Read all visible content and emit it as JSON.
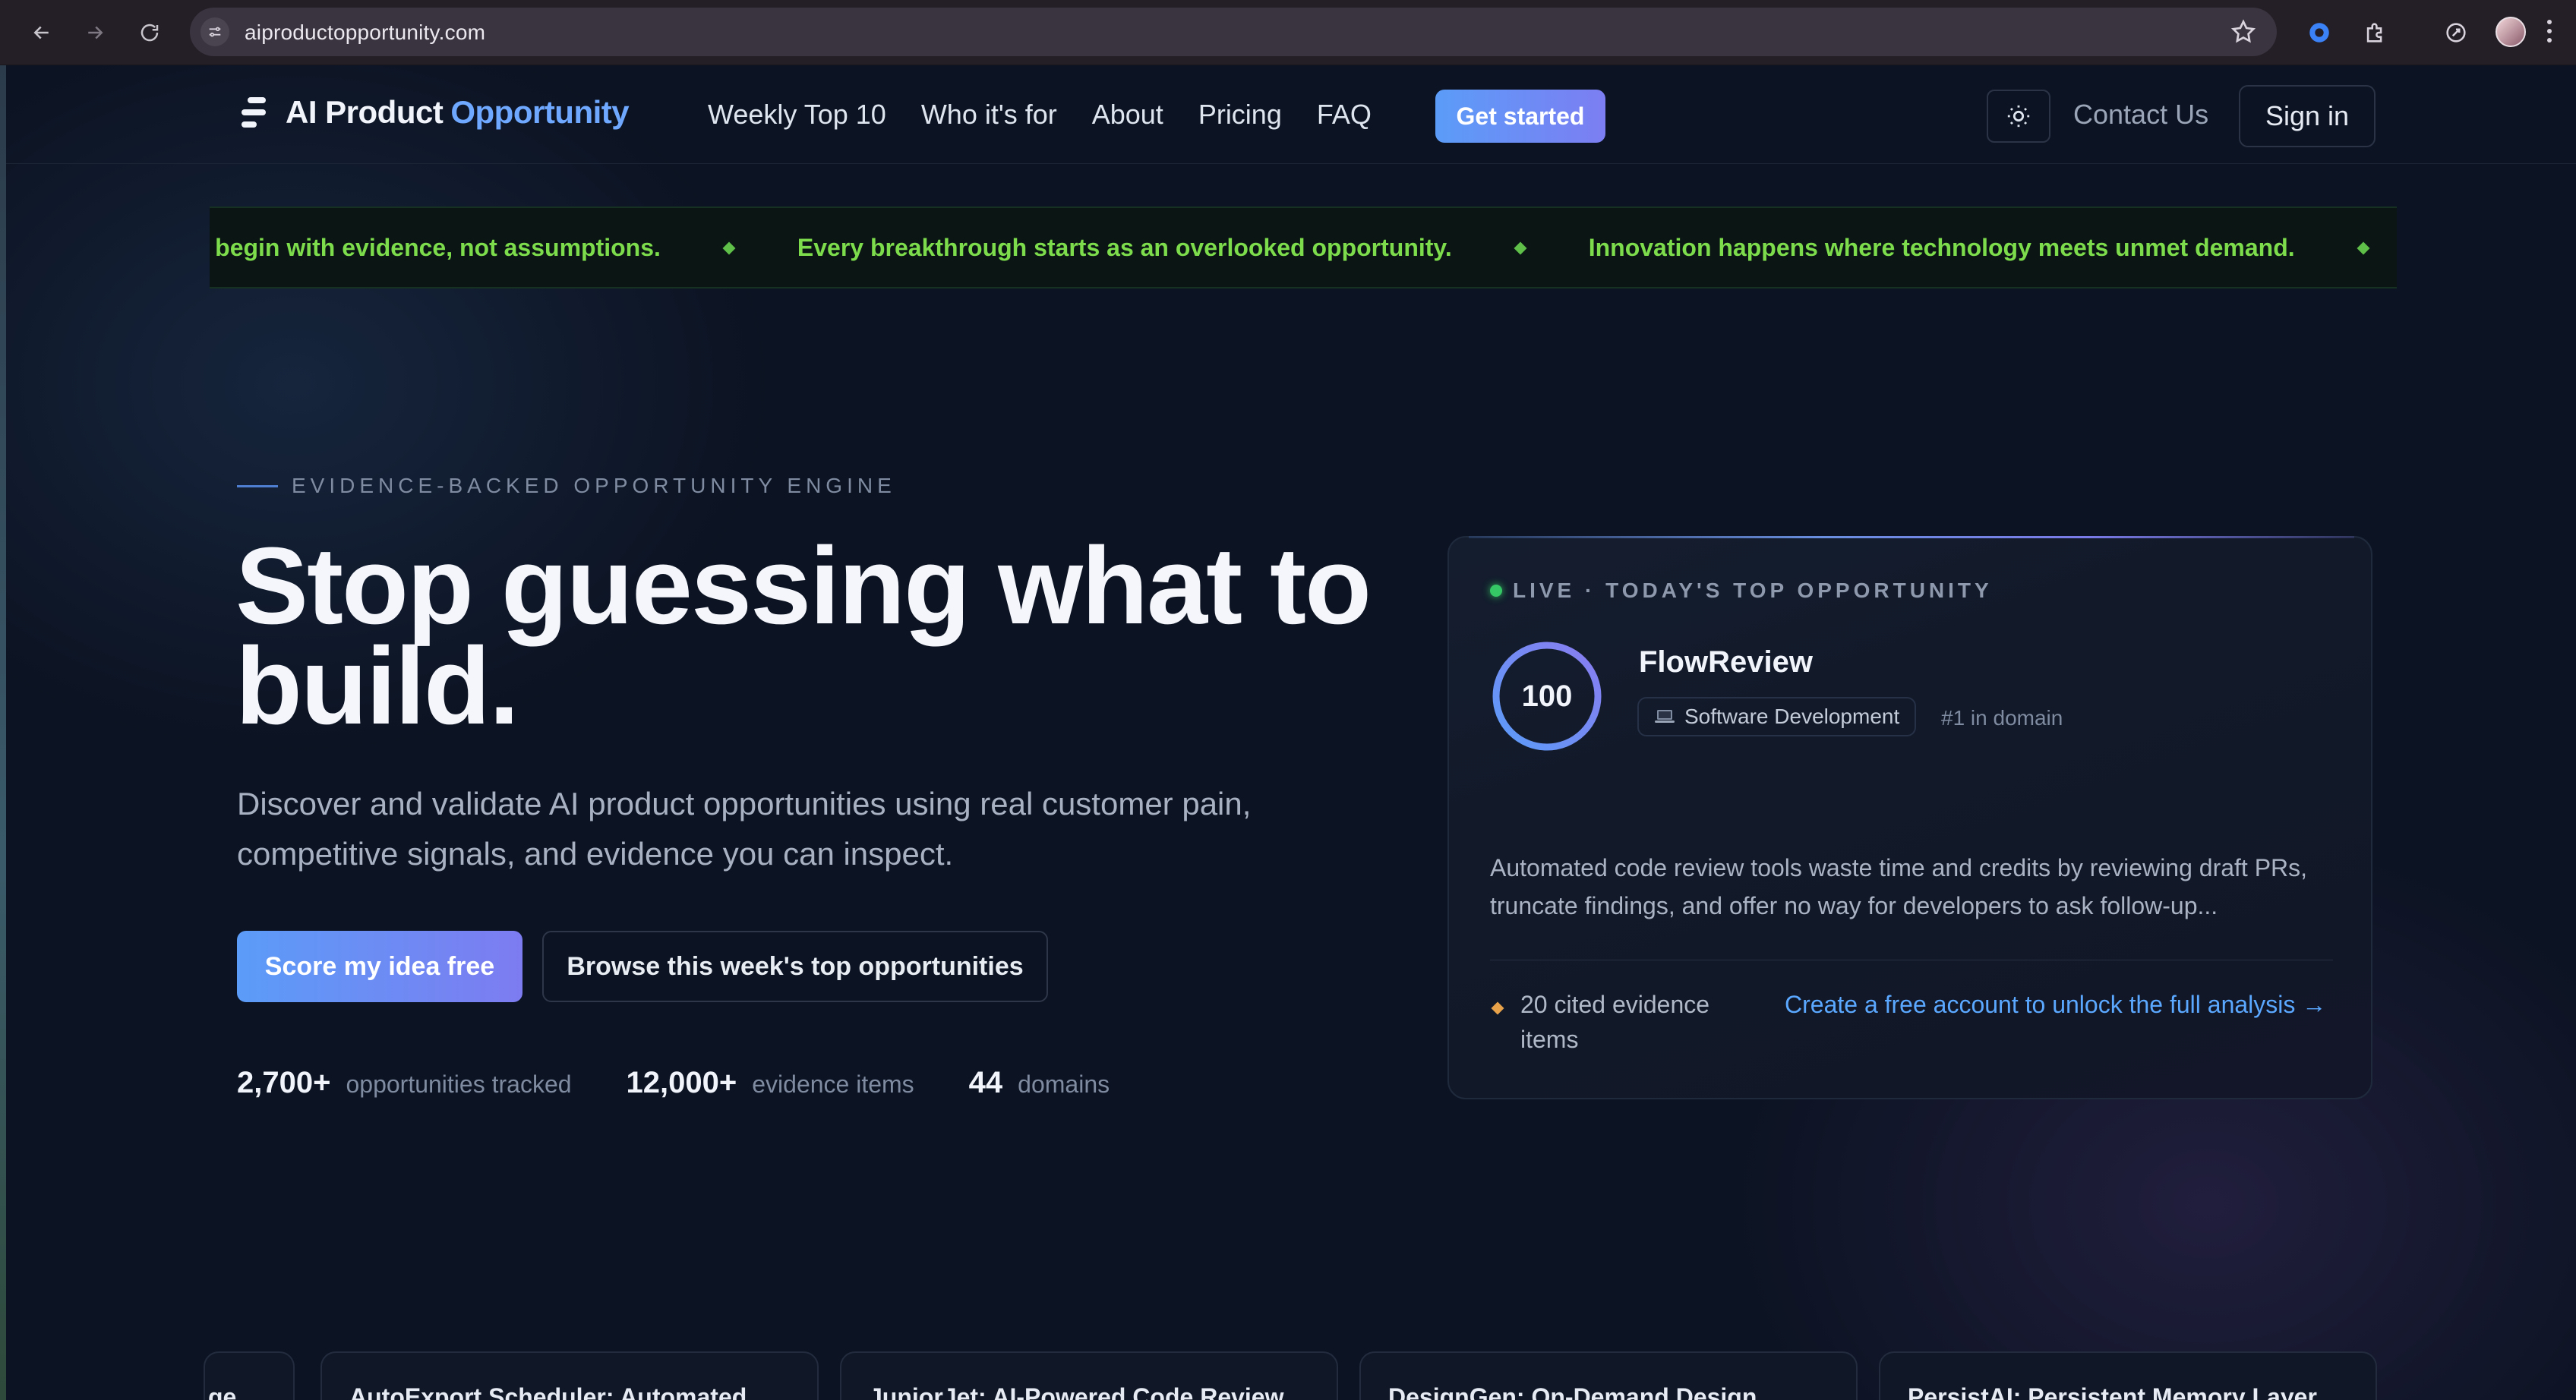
{
  "browser": {
    "url": "aiproductopportunity.com"
  },
  "nav": {
    "brand_part1": "AI Product",
    "brand_part2": "Opportunity",
    "links": [
      "Weekly Top 10",
      "Who it's for",
      "About",
      "Pricing",
      "FAQ"
    ],
    "cta": "Get started",
    "contact": "Contact Us",
    "signin": "Sign in"
  },
  "ticker": {
    "items": [
      "cts begin with evidence, not assumptions.",
      "Every breakthrough starts as an overlooked opportunity.",
      "Innovation happens where technology meets unmet demand."
    ]
  },
  "hero": {
    "eyebrow": "EVIDENCE-BACKED OPPORTUNITY ENGINE",
    "title": "Stop guessing what to build.",
    "subtitle": "Discover and validate AI product opportunities using real customer pain, competitive signals, and evidence you can inspect.",
    "primary_button": "Score my idea free",
    "secondary_button": "Browse this week's top opportunities",
    "stats": [
      {
        "value": "2,700+",
        "label": "opportunities tracked"
      },
      {
        "value": "12,000+",
        "label": "evidence items"
      },
      {
        "value": "44",
        "label": "domains"
      }
    ]
  },
  "live_card": {
    "header": "LIVE · TODAY'S TOP OPPORTUNITY",
    "score": "100",
    "score_fraction": 1.0,
    "name": "FlowReview",
    "domain": "Software Development",
    "rank": "#1 in domain",
    "description": "Automated code review tools waste time and credits by reviewing draft PRs, truncate findings, and offer no way for developers to ask follow-up...",
    "evidence": "20 cited evidence items",
    "unlock": "Create a free account to unlock the full analysis →"
  },
  "opportunity_cards": [
    "ge",
    "AutoExport Scheduler: Automated Data Exports for Maho Commerce",
    "JuniorJet: AI-Powered Code Review Mentorship for New Engineers",
    "DesignGen: On-Demand Design Asset API",
    "PersistAI: Persistent Memory Layer for AI Coding Assistants"
  ],
  "colors": {
    "accent": "#5b9cf8",
    "ticker_text": "#7ddc4b",
    "live": "#35c766",
    "link": "#5aa8ff"
  }
}
